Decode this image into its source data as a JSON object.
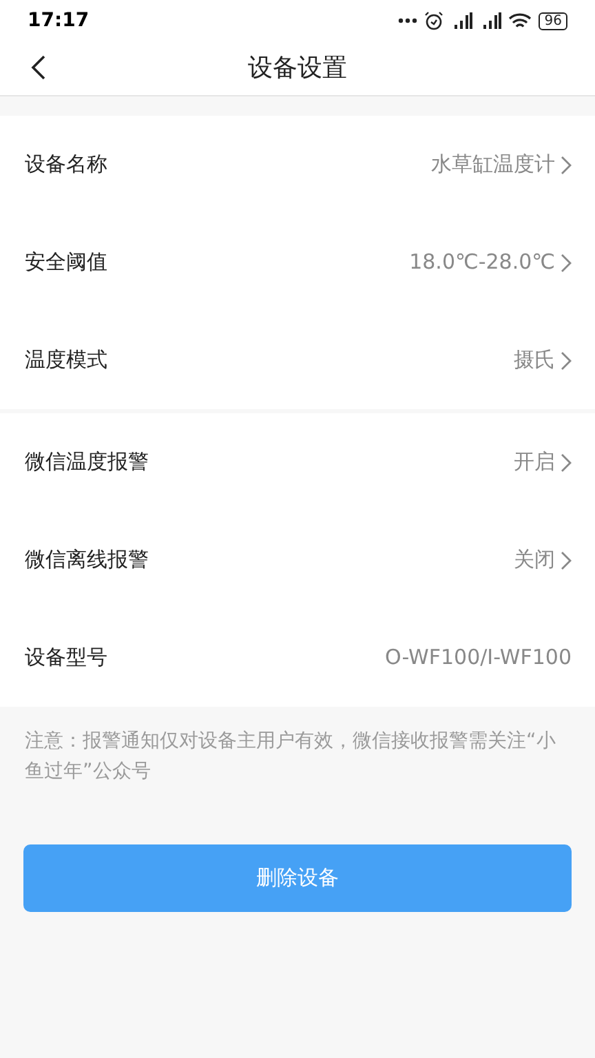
{
  "status_bar": {
    "time": "17:17",
    "battery": "96"
  },
  "header": {
    "title": "设备设置"
  },
  "groups": [
    {
      "rows": [
        {
          "label": "设备名称",
          "value": "水草缸温度计",
          "kind": "link"
        },
        {
          "label": "安全阈值",
          "value": "18.0℃-28.0℃",
          "kind": "link"
        },
        {
          "label": "温度模式",
          "value": "摄氏",
          "kind": "link"
        }
      ]
    },
    {
      "rows": [
        {
          "label": "微信温度报警",
          "value": "开启",
          "kind": "link"
        },
        {
          "label": "微信离线报警",
          "value": "关闭",
          "kind": "link"
        },
        {
          "label": "设备型号",
          "value": "O-WF100/I-WF100",
          "kind": "info"
        }
      ]
    }
  ],
  "note": "注意：报警通知仅对设备主用户有效，微信接收报警需关注“小鱼过年”公众号",
  "delete_button": "删除设备"
}
